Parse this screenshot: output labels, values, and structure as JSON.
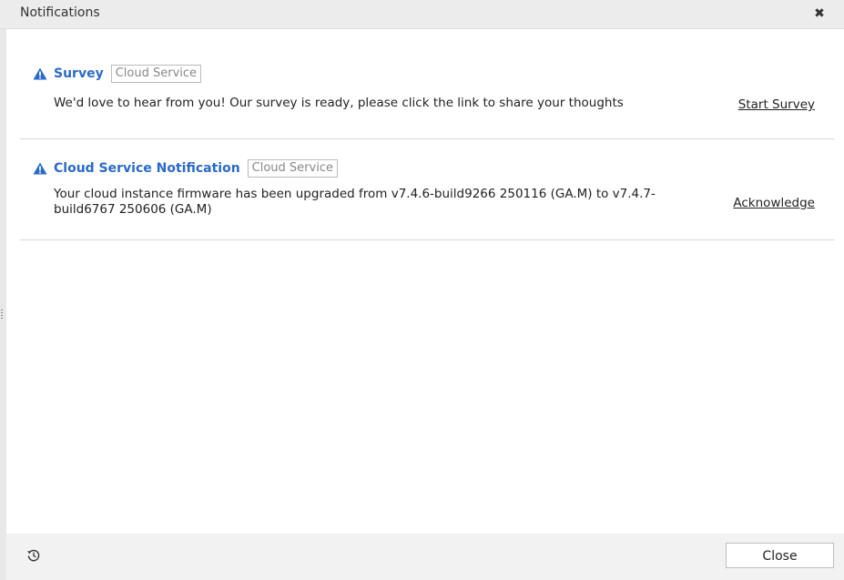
{
  "dialog": {
    "title": "Notifications",
    "close_icon": "close-icon"
  },
  "notifications": [
    {
      "icon": "warning-icon",
      "title": "Survey",
      "tag": "Cloud Service",
      "message": "We'd love to hear from you! Our survey is ready, please click the link to share your thoughts",
      "action": "Start Survey"
    },
    {
      "icon": "warning-icon",
      "title": "Cloud Service Notification",
      "tag": "Cloud Service",
      "message": "Your cloud instance firmware has been upgraded from v7.4.6-build9266 250116 (GA.M) to v7.4.7-build6767 250606 (GA.M)",
      "action": "Acknowledge"
    }
  ],
  "footer": {
    "history_icon": "history-icon",
    "close_label": "Close"
  },
  "colors": {
    "accent": "#2a6ac9",
    "titlebar": "#ececec",
    "footer": "#f2f2f2"
  }
}
